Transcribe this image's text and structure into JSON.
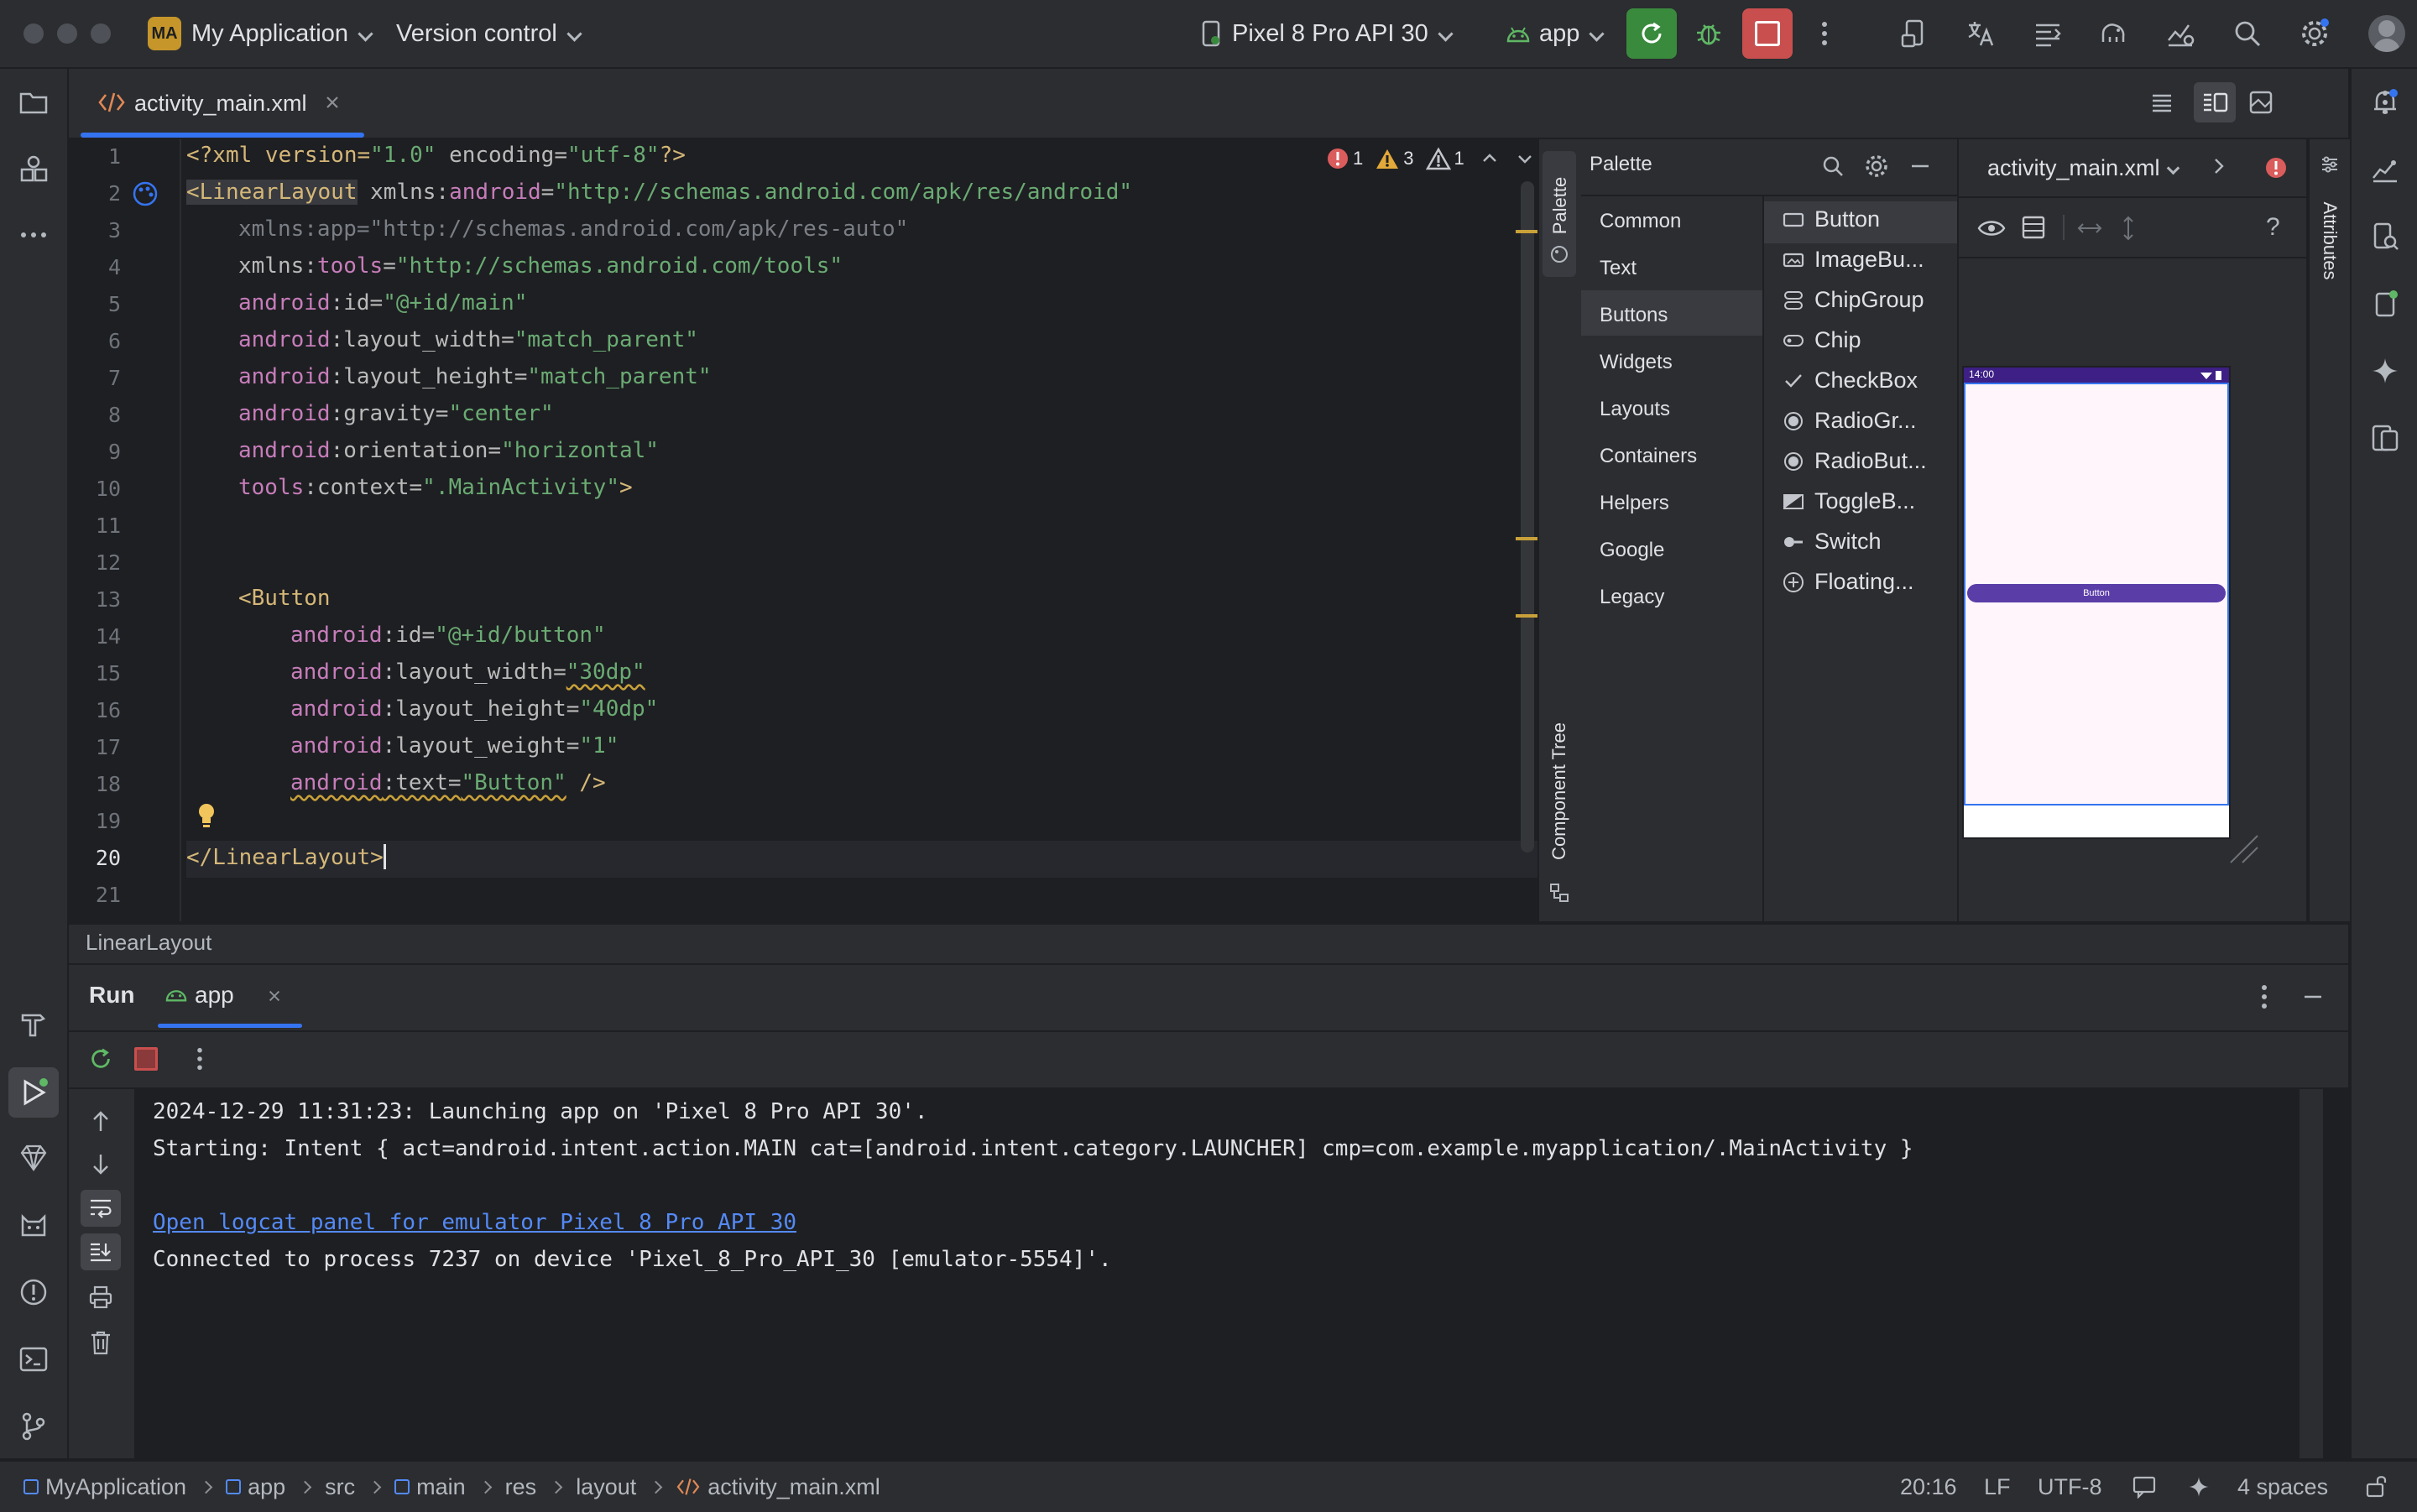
{
  "titlebar": {
    "project_badge": "MA",
    "project_name": "My Application",
    "vcs_label": "Version control",
    "device_label": "Pixel 8 Pro API 30",
    "run_config": "app"
  },
  "editor_tab": {
    "file_name": "activity_main.xml"
  },
  "inspections": {
    "errors": "1",
    "warnings": "3",
    "weak_warnings": "1"
  },
  "editor": {
    "line_numbers": [
      "1",
      "2",
      "3",
      "4",
      "5",
      "6",
      "7",
      "8",
      "9",
      "10",
      "11",
      "12",
      "13",
      "14",
      "15",
      "16",
      "17",
      "18",
      "19",
      "20",
      "21"
    ],
    "lines": {
      "l1": [
        "<?xml version=",
        "\"1.0\"",
        " encoding=",
        "\"utf-8\"",
        "?>"
      ],
      "l2": [
        "<LinearLayout",
        " xmlns:",
        "android",
        "=",
        "\"http://schemas.android.com/apk/res/android\""
      ],
      "l3": [
        "xmlns:app=",
        "\"http://schemas.android.com/apk/res-auto\""
      ],
      "l4": [
        "xmlns:",
        "tools",
        "=",
        "\"http://schemas.android.com/tools\""
      ],
      "l5": [
        "android",
        ":id=",
        "\"@+id/main\""
      ],
      "l6": [
        "android",
        ":layout_width=",
        "\"match_parent\""
      ],
      "l7": [
        "android",
        ":layout_height=",
        "\"match_parent\""
      ],
      "l8": [
        "android",
        ":gravity=",
        "\"center\""
      ],
      "l9": [
        "android",
        ":orientation=",
        "\"horizontal\""
      ],
      "l10": [
        "tools",
        ":context=",
        "\".MainActivity\"",
        ">"
      ],
      "l13": [
        "<Button"
      ],
      "l14": [
        "android",
        ":id=",
        "\"@+id/button\""
      ],
      "l15": [
        "android",
        ":layout_width=",
        "\"30dp\""
      ],
      "l16": [
        "android",
        ":layout_height=",
        "\"40dp\""
      ],
      "l17": [
        "android",
        ":layout_weight=",
        "\"1\""
      ],
      "l18": [
        "android",
        ":text=",
        "\"Button\"",
        " />"
      ],
      "l20": [
        "</LinearLayout>"
      ]
    }
  },
  "palette": {
    "title": "Palette",
    "categories": [
      "Common",
      "Text",
      "Buttons",
      "Widgets",
      "Layouts",
      "Containers",
      "Helpers",
      "Google",
      "Legacy"
    ],
    "selected_category": "Buttons",
    "items": [
      "Button",
      "ImageBu...",
      "ChipGroup",
      "Chip",
      "CheckBox",
      "RadioGr...",
      "RadioBut...",
      "ToggleB...",
      "Switch",
      "Floating..."
    ]
  },
  "side_tabs": {
    "palette": "Palette",
    "component_tree": "Component Tree",
    "attributes": "Attributes"
  },
  "design": {
    "file_name": "activity_main.xml",
    "phone_time": "14:00",
    "phone_button_text": "Button"
  },
  "breadcrumb_bar": {
    "component": "LinearLayout"
  },
  "run_panel": {
    "title": "Run",
    "tab": "app",
    "console": [
      "2024-12-29 11:31:23: Launching app on 'Pixel 8 Pro API 30'.",
      "Starting: Intent { act=android.intent.action.MAIN cat=[android.intent.category.LAUNCHER] cmp=com.example.myapplication/.MainActivity }",
      "Open logcat panel for emulator Pixel 8 Pro API 30",
      "Connected to process 7237 on device 'Pixel_8_Pro_API_30 [emulator-5554]'."
    ]
  },
  "statusbar": {
    "path": [
      "MyApplication",
      "app",
      "src",
      "main",
      "res",
      "layout",
      "activity_main.xml"
    ],
    "cursor_position": "20:16",
    "line_separator": "LF",
    "encoding": "UTF-8",
    "indent": "4 spaces"
  },
  "colors": {
    "background": "#1e1f22",
    "panel": "#2b2d30",
    "accent": "#3574f0",
    "run_green": "#3a8a3e",
    "stop_red": "#c94f4f",
    "xml_tag": "#d5b778",
    "xml_namespace": "#c77dbb",
    "xml_value": "#6aab73",
    "phone_button": "#5b3da8"
  }
}
